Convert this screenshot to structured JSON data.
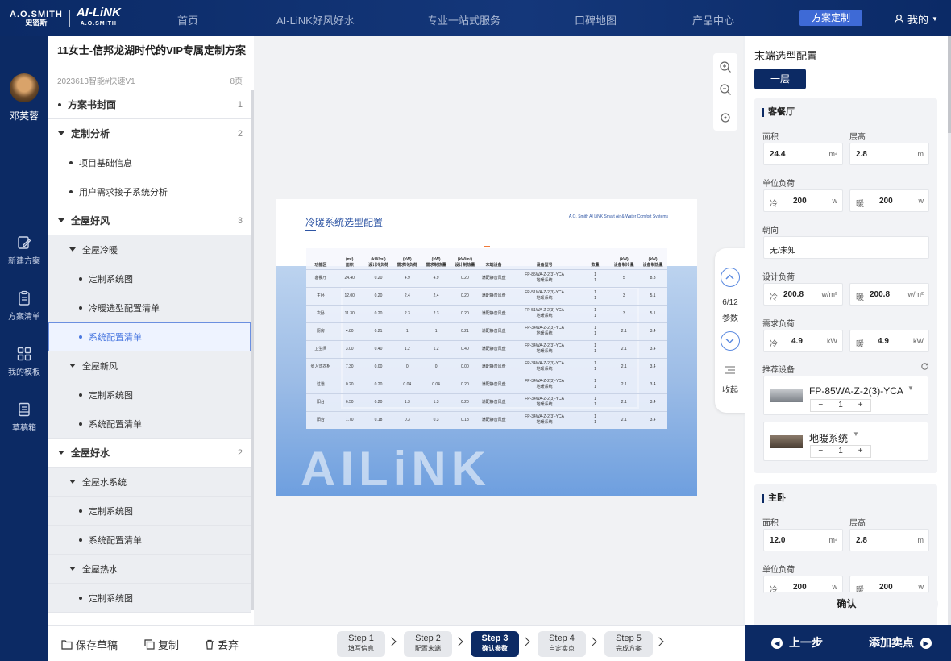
{
  "brand": {
    "ao_top": "A.O.SMITH",
    "ao_bottom": "史密斯",
    "ai_top": "AI-LiNK",
    "ai_bottom": "A.O.SMITH"
  },
  "nav": {
    "items": [
      "首页",
      "AI-LiNK好风好水",
      "专业一站式服务",
      "口碑地图",
      "产品中心"
    ],
    "active": "方案定制",
    "user": "我的"
  },
  "sidebar": {
    "username": "邓芙蓉",
    "items": [
      {
        "label": "新建方案",
        "icon": "edit-icon"
      },
      {
        "label": "方案清单",
        "icon": "list-icon"
      },
      {
        "label": "我的模板",
        "icon": "grid-icon"
      },
      {
        "label": "草稿箱",
        "icon": "draft-icon"
      }
    ]
  },
  "outline": {
    "title": "11女士-信邦龙湖时代的VIP专属定制方案",
    "subtitle": "2023613智能#快速V1",
    "pages": "8页",
    "rows": [
      {
        "label": "方案书封面",
        "num": "1"
      },
      {
        "label": "定制分析",
        "num": "2"
      },
      {
        "label": "项目基础信息",
        "num": ""
      },
      {
        "label": "用户需求接子系统分析",
        "num": ""
      },
      {
        "label": "全屋好风",
        "num": "3"
      },
      {
        "label": "全屋冷暖",
        "num": ""
      },
      {
        "label": "定制系统图",
        "num": ""
      },
      {
        "label": "冷暖选型配置清单",
        "num": ""
      },
      {
        "label": "系统配置清单",
        "num": ""
      },
      {
        "label": "全屋新风",
        "num": ""
      },
      {
        "label": "定制系统图",
        "num": ""
      },
      {
        "label": "系统配置清单",
        "num": ""
      },
      {
        "label": "全屋好水",
        "num": "2"
      },
      {
        "label": "全屋水系统",
        "num": ""
      },
      {
        "label": "定制系统图",
        "num": ""
      },
      {
        "label": "系统配置清单",
        "num": ""
      },
      {
        "label": "全屋热水",
        "num": ""
      },
      {
        "label": "定制系统图",
        "num": ""
      }
    ]
  },
  "preview": {
    "title": "冷暖系统选型配置",
    "brand_line": "A.O. Smith AI LiNK Smart Air & Water Comfort Systems",
    "watermark": "AILiNK",
    "headers": [
      [
        "功能区",
        ""
      ],
      [
        "(m²)",
        "面积"
      ],
      [
        "(kW/m²)",
        "设计冷负荷"
      ],
      [
        "(kW)",
        "需求冷负荷"
      ],
      [
        "(kW)",
        "需求制热量"
      ],
      [
        "(kW/m²)",
        "设计制热量"
      ],
      [
        "",
        "末端设备"
      ],
      [
        "",
        "设备型号"
      ],
      [
        "",
        "数量"
      ],
      [
        "(kW)",
        "设备制冷量"
      ],
      [
        "(kW)",
        "设备制热量"
      ]
    ],
    "rows": [
      [
        "客餐厅",
        "24.40",
        "0.20",
        "4.9",
        "4.9",
        "0.20",
        "满配静音风盘",
        "FP-85WA-Z-2(3)-YCA\n地暖系统",
        "1\n1",
        "5",
        "8.3"
      ],
      [
        "主卧",
        "12.00",
        "0.20",
        "2.4",
        "2.4",
        "0.20",
        "满配静音风盘",
        "FP-51WA-Z-2(3)-YCA\n地暖系统",
        "1\n1",
        "3",
        "5.1"
      ],
      [
        "次卧",
        "11.30",
        "0.20",
        "2.3",
        "2.3",
        "0.20",
        "满配静音风盘",
        "FP-51WA-Z-2(3)-YCA\n地暖系统",
        "1\n1",
        "3",
        "5.1"
      ],
      [
        "厨房",
        "4.80",
        "0.21",
        "1",
        "1",
        "0.21",
        "满配静音风盘",
        "FP-34WA-Z-2(3)-YCA\n地暖系统",
        "1\n1",
        "2.1",
        "3.4"
      ],
      [
        "卫生间",
        "3.00",
        "0.40",
        "1.2",
        "1.2",
        "0.40",
        "满配静音风盘",
        "FP-34WA-Z-2(3)-YCA\n地暖系统",
        "1\n1",
        "2.1",
        "3.4"
      ],
      [
        "步入式衣柜",
        "7.30",
        "0.00",
        "0",
        "0",
        "0.00",
        "满配静音风盘",
        "FP-34WA-Z-2(3)-YCA\n地暖系统",
        "1\n1",
        "2.1",
        "3.4"
      ],
      [
        "过道",
        "0.20",
        "0.20",
        "0.04",
        "0.04",
        "0.20",
        "满配静音风盘",
        "FP-34WA-Z-2(3)-YCA\n地暖系统",
        "1\n1",
        "2.1",
        "3.4"
      ],
      [
        "阳台",
        "6.50",
        "0.20",
        "1.3",
        "1.3",
        "0.20",
        "满配静音风盘",
        "FP-34WA-Z-2(3)-YCA\n地暖系统",
        "1\n1",
        "2.1",
        "3.4"
      ],
      [
        "阳台",
        "1.70",
        "0.18",
        "0.3",
        "0.3",
        "0.18",
        "满配静音风盘",
        "FP-34WA-Z-2(3)-YCA\n地暖系统",
        "1\n1",
        "2.1",
        "3.4"
      ]
    ]
  },
  "param_nav": {
    "progress": "6/12",
    "label": "参数",
    "collapse": "收起"
  },
  "config": {
    "title": "末端选型配置",
    "floor": "一层",
    "labels": {
      "area": "面积",
      "height": "层高",
      "unit_load": "单位负荷",
      "orient": "朝向",
      "design_load": "设计负荷",
      "need_load": "需求负荷",
      "rec": "推荐设备",
      "cool": "冷",
      "heat": "暖"
    },
    "rooms": [
      {
        "name": "客餐厅",
        "area": "24.4",
        "area_unit": "m²",
        "height": "2.8",
        "height_unit": "m",
        "unit_cool": "200",
        "unit_heat": "200",
        "unit_u": "w",
        "orient": "无/未知",
        "design_cool": "200.8",
        "design_heat": "200.8",
        "design_unit": "w/m²",
        "need_cool": "4.9",
        "need_heat": "4.9",
        "need_unit": "kW",
        "devices": [
          {
            "name": "FP-85WA-Z-2(3)-YCA",
            "qty": "1"
          },
          {
            "name": "地暖系统",
            "qty": "1"
          }
        ]
      },
      {
        "name": "主卧",
        "area": "12.0",
        "area_unit": "m²",
        "height": "2.8",
        "height_unit": "m",
        "unit_cool": "200",
        "unit_heat": "200",
        "unit_u": "w"
      }
    ],
    "confirm": "确认"
  },
  "footer": {
    "save": "保存草稿",
    "copy": "复制",
    "discard": "丢弃",
    "steps": [
      {
        "t": "Step 1",
        "s": "填写信息"
      },
      {
        "t": "Step 2",
        "s": "配置末端"
      },
      {
        "t": "Step 3",
        "s": "确认参数"
      },
      {
        "t": "Step 4",
        "s": "自定卖点"
      },
      {
        "t": "Step 5",
        "s": "完成方案"
      }
    ],
    "prev": "上一步",
    "next": "添加卖点"
  }
}
